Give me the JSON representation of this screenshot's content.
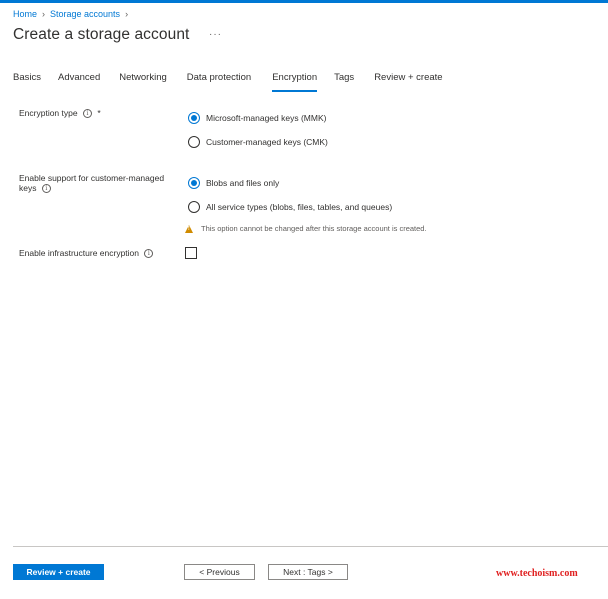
{
  "breadcrumb": [
    {
      "label": "Home"
    },
    {
      "label": "Storage accounts"
    }
  ],
  "page": {
    "title": "Create a storage account",
    "more_label": "···"
  },
  "tabs": [
    {
      "label": "Basics",
      "active": false
    },
    {
      "label": "Advanced",
      "active": false
    },
    {
      "label": "Networking",
      "active": false
    },
    {
      "label": "Data protection",
      "active": false
    },
    {
      "label": "Encryption",
      "active": true
    },
    {
      "label": "Tags",
      "active": false
    },
    {
      "label": "Review + create",
      "active": false
    }
  ],
  "encryption_type": {
    "label": "Encryption type",
    "required_mark": "*",
    "options": [
      {
        "label": "Microsoft-managed keys (MMK)",
        "checked": true
      },
      {
        "label": "Customer-managed keys (CMK)",
        "checked": false
      }
    ]
  },
  "cmk_support": {
    "label": "Enable support for customer-managed keys",
    "options": [
      {
        "label": "Blobs and files only",
        "checked": true
      },
      {
        "label": "All service types (blobs, files, tables, and queues)",
        "checked": false
      }
    ],
    "warning": "This option cannot be changed after this storage account is created."
  },
  "infrastructure_encryption": {
    "label": "Enable infrastructure encryption",
    "checked": false
  },
  "footer": {
    "review_create": "Review + create",
    "previous": "< Previous",
    "next": "Next : Tags >"
  },
  "watermark": "www.techoism.com",
  "colors": {
    "accent": "#0078d4",
    "warning": "#d08b00",
    "watermark": "#e02020"
  }
}
